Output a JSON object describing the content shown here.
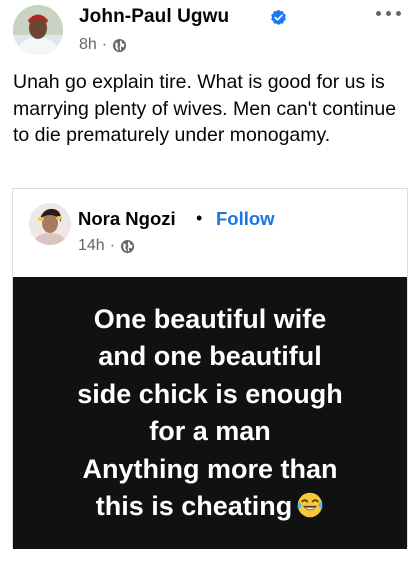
{
  "post": {
    "author": "John-Paul Ugwu",
    "time": "8h",
    "separator": "·",
    "more_icon": "more-horizontal-icon",
    "text": "Unah go explain tire. What is good for us is marrying plenty of wives. Men can't continue to die prematurely under monogamy."
  },
  "shared": {
    "author": "Nora Ngozi",
    "bullet": "•",
    "follow_label": "Follow",
    "time": "14h",
    "separator": "·",
    "image_lines": [
      "One beautiful wife",
      "and one beautiful",
      "side chick is enough",
      "for a man",
      "Anything more than",
      "this is cheating"
    ],
    "emoji": "face-with-tears-of-joy-icon"
  },
  "colors": {
    "accent": "#1b74e4",
    "verified": "#1877f2",
    "meta_gray": "#65676b",
    "image_bg": "#111111"
  }
}
